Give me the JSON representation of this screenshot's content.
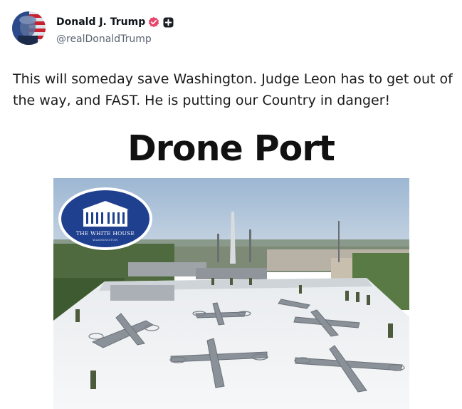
{
  "author": {
    "display_name": "Donald J. Trump",
    "handle": "@realDonaldTrump",
    "verified_icon": "verified-badge-icon",
    "plus_icon": "plus-square-icon"
  },
  "post": {
    "text": "This will someday save Washington. Judge Leon has to get out of the way, and FAST. He is putting our Country in danger!"
  },
  "image": {
    "title": "Drone Port",
    "seal_line_1": "THE WHITE HOUSE",
    "seal_line_2": "WASHINGTON"
  },
  "colors": {
    "verified_badge": "#e8456b",
    "seal_blue": "#1f3f8f",
    "roof": "#f2f4f6",
    "sky": "#a9c0d8"
  }
}
